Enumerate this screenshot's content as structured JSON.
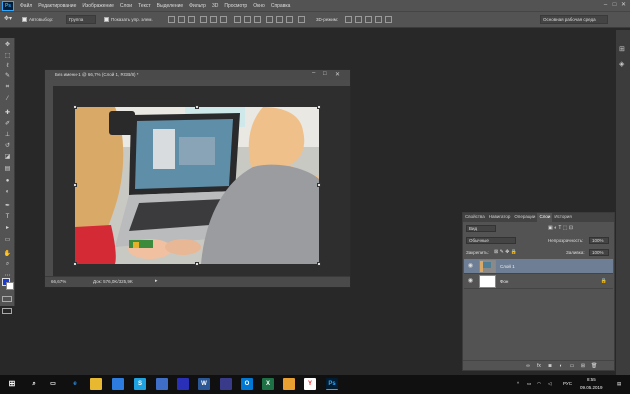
{
  "app": {
    "logo": "Ps"
  },
  "menu": [
    "Файл",
    "Редактирование",
    "Изображение",
    "Слои",
    "Текст",
    "Выделение",
    "Фильтр",
    "3D",
    "Просмотр",
    "Окно",
    "Справка"
  ],
  "options": {
    "autoselect_label": "Автовыбор:",
    "autoselect_value": "Группа",
    "transform_label": "Показать упр. элем.",
    "mode3d_label": "3D-режим:",
    "workspace": "Основная рабочая среда"
  },
  "document": {
    "title": "Без имени-1 @ 66,7% (Слой 1, RGB/8) *",
    "zoom": "66,67%",
    "doc_size": "Док: 576,0K/325,9K"
  },
  "layers_panel": {
    "tabs": [
      "Свойства",
      "Навигатор",
      "Операции",
      "Слои",
      "История"
    ],
    "active_tab": "Слои",
    "filter_kind": "Вид",
    "blend_mode": "Обычные",
    "opacity_label": "Непрозрачность:",
    "opacity_value": "100%",
    "lock_label": "Закрепить:",
    "fill_label": "Заливка:",
    "fill_value": "100%",
    "layers": [
      {
        "name": "Слой 1",
        "selected": true
      },
      {
        "name": "Фон",
        "selected": false
      }
    ]
  },
  "taskbar": {
    "lang": "РУС",
    "time": "8:55",
    "date": "09.05.2019"
  },
  "colors": {
    "foreground": "#1a3ad8",
    "background": "#ffffff",
    "selected_layer": "#6d7e95"
  }
}
